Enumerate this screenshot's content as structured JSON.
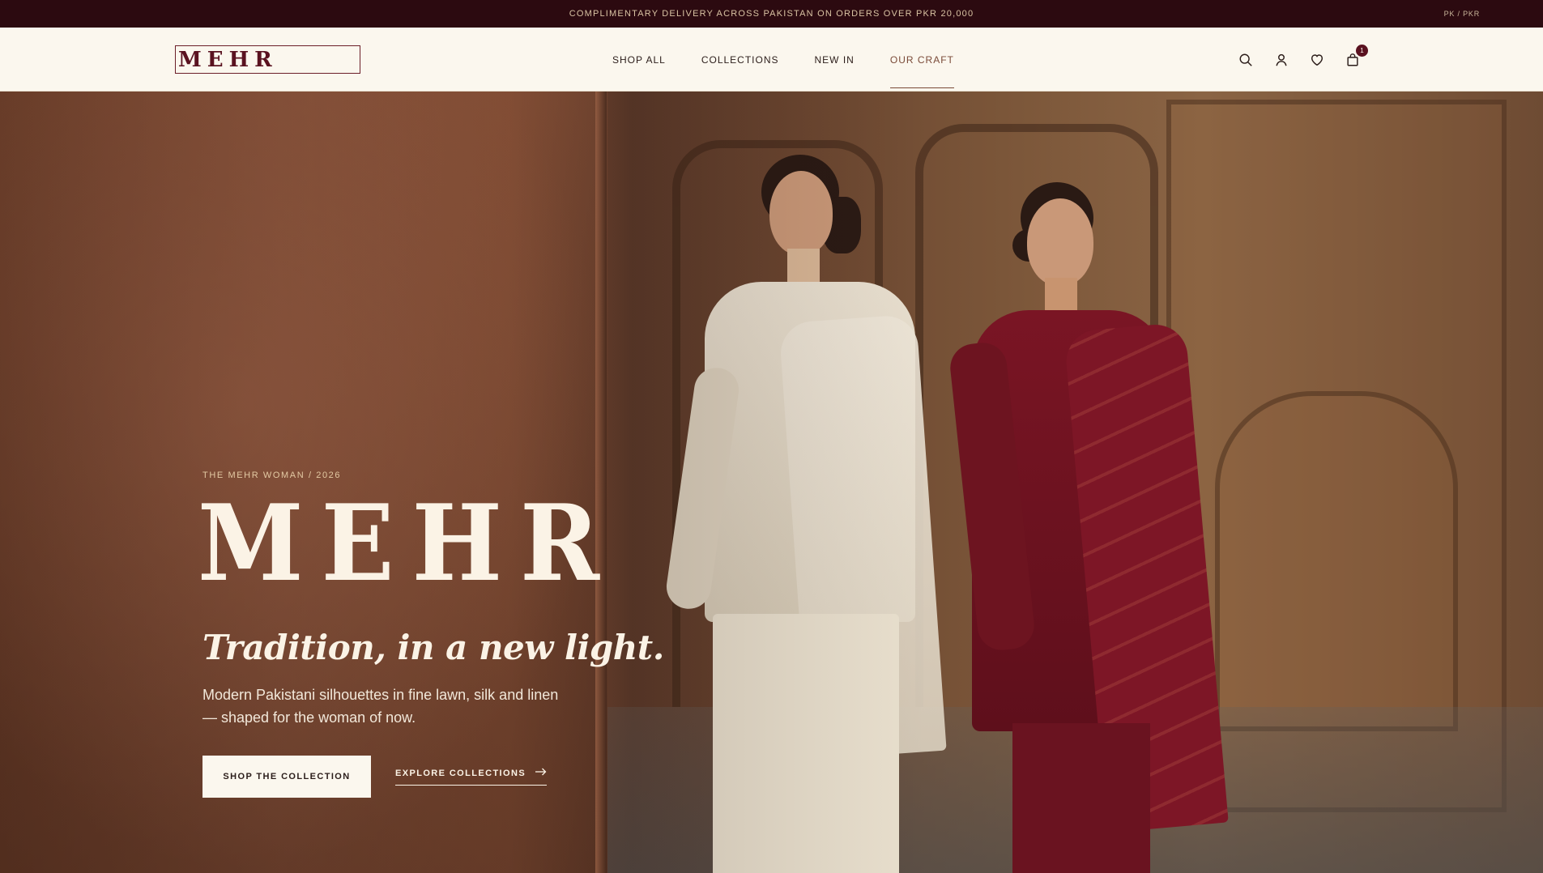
{
  "announcement": {
    "text": "COMPLIMENTARY DELIVERY ACROSS PAKISTAN ON ORDERS OVER PKR 20,000",
    "locale": "PK / PKR"
  },
  "header": {
    "logo": "MEHR",
    "nav": [
      {
        "label": "SHOP ALL",
        "active": false
      },
      {
        "label": "COLLECTIONS",
        "active": false
      },
      {
        "label": "NEW IN",
        "active": false
      },
      {
        "label": "OUR CRAFT",
        "active": true
      }
    ],
    "icons": [
      "search-icon",
      "account-icon",
      "wishlist-heart-icon",
      "shopping-bag-icon"
    ],
    "cart_count": "1"
  },
  "hero": {
    "eyebrow": "THE MEHR WOMAN / 2026",
    "title": "MEHR",
    "tagline": "Tradition, in a new light.",
    "description": "Modern Pakistani silhouettes in fine lawn, silk and linen — shaped for the woman of now.",
    "primary_cta": "SHOP THE COLLECTION",
    "secondary_cta": "EXPLORE COLLECTIONS"
  },
  "colors": {
    "announcement_bg": "#2c0a10",
    "header_bg": "#fbf7ee",
    "brand_maroon": "#5a1220",
    "hero_text": "#fbf3e6"
  }
}
